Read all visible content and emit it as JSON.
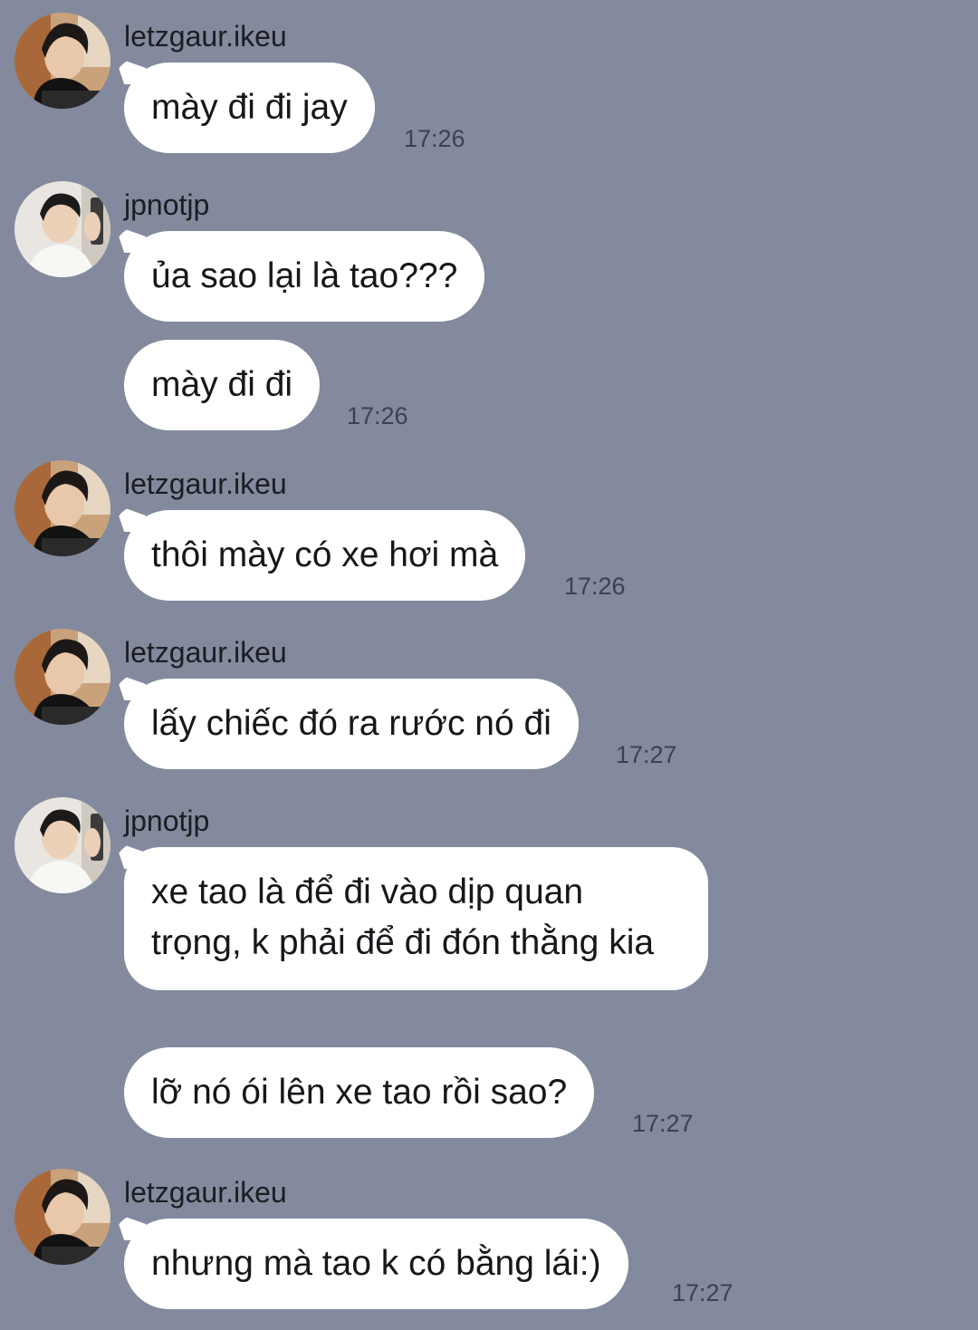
{
  "colors": {
    "background": "#838a9d",
    "bubble": "#ffffff",
    "text": "#15171b",
    "time": "#3b4152"
  },
  "messages": [
    {
      "sender": "letzgaur.ikeu",
      "avatar": "letzgaur-avatar-icon",
      "texts": [
        "mày đi đi jay"
      ],
      "time": "17:26"
    },
    {
      "sender": "jpnotjp",
      "avatar": "jpnotjp-avatar-icon",
      "texts": [
        "ủa sao lại là tao???",
        "mày đi đi"
      ],
      "time": "17:26"
    },
    {
      "sender": "letzgaur.ikeu",
      "avatar": "letzgaur-avatar-icon",
      "texts": [
        "thôi mày có xe hơi mà"
      ],
      "time": "17:26"
    },
    {
      "sender": "letzgaur.ikeu",
      "avatar": "letzgaur-avatar-icon",
      "texts": [
        "lấy chiếc đó ra rước nó đi"
      ],
      "time": "17:27"
    },
    {
      "sender": "jpnotjp",
      "avatar": "jpnotjp-avatar-icon",
      "texts": [
        "xe tao là để đi vào dịp quan trọng, k phải để đi đón thằng kia",
        "lỡ nó ói lên xe tao rồi sao?"
      ],
      "time": "17:27"
    },
    {
      "sender": "letzgaur.ikeu",
      "avatar": "letzgaur-avatar-icon",
      "texts": [
        "nhưng mà tao k có bằng lái:)"
      ],
      "time": "17:27"
    }
  ]
}
